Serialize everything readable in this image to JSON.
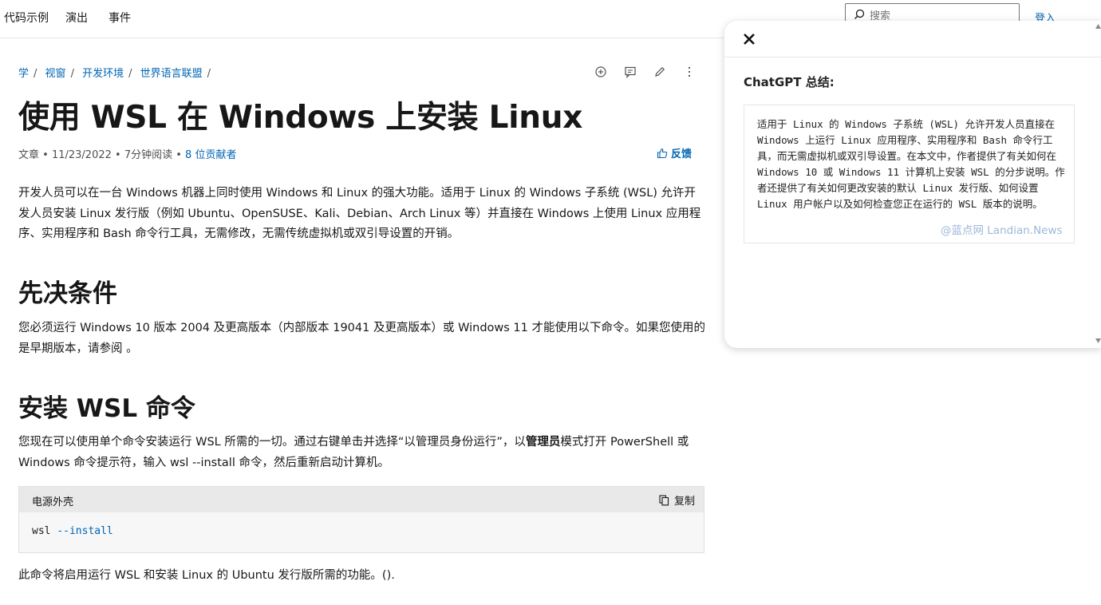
{
  "nav": {
    "items": [
      "代码示例",
      "演出",
      "事件"
    ],
    "search_placeholder": "搜索",
    "signin": "登入"
  },
  "breadcrumb": [
    "学",
    "视窗",
    "开发环境",
    "世界语言联盟"
  ],
  "article": {
    "title": "使用 WSL 在 Windows 上安装 Linux",
    "meta_type": "文章",
    "meta_date": "11/23/2022",
    "meta_read": "7分钟阅读",
    "meta_contributors": "8 位贡献者",
    "feedback": "反馈",
    "intro": "开发人员可以在一台 Windows 机器上同时使用 Windows 和 Linux 的强大功能。适用于 Linux 的 Windows 子系统 (WSL) 允许开发人员安装 Linux 发行版（例如 Ubuntu、OpenSUSE、Kali、Debian、Arch Linux 等）并直接在 Windows 上使用 Linux 应用程序、实用程序和 Bash 命令行工具，无需修改，无需传统虚拟机或双引导设置的开销。",
    "h2_prereq": "先决条件",
    "prereq_text": "您必须运行 Windows 10 版本 2004 及更高版本（内部版本 19041 及更高版本）或 Windows 11 才能使用以下命令。如果您使用的是早期版本，请参阅 。",
    "h2_install": "安装 WSL 命令",
    "install_text_a": "您现在可以使用单个命令安装运行 WSL 所需的一切。通过右键单击并选择“以管理员身份运行”，以",
    "install_text_bold": "管理员",
    "install_text_b": "模式打开 PowerShell 或 Windows 命令提示符，输入 wsl --install 命令，然后重新启动计算机。",
    "code_lang": "电源外壳",
    "copy_label": "复制",
    "code_cmd": "wsl",
    "code_arg": "--install",
    "after_code": "此命令将启用运行 WSL 和安装 Linux 的 Ubuntu 发行版所需的功能。()."
  },
  "gpt": {
    "title": "ChatGPT 总结:",
    "summary": "适用于 Linux 的 Windows 子系统 (WSL) 允许开发人员直接在 Windows 上运行 Linux 应用程序、实用程序和 Bash 命令行工具，而无需虚拟机或双引导设置。在本文中，作者提供了有关如何在 Windows 10 或 Windows 11 计算机上安装 WSL 的分步说明。作者还提供了有关如何更改安装的默认 Linux 发行版、如何设置 Linux 用户帐户以及如何检查您正在运行的 WSL 版本的说明。",
    "watermark": "@蓝点网 Landian.News"
  },
  "colors": {
    "link": "#0065b3",
    "text": "#171717",
    "code_bg": "#f7f7f7"
  }
}
